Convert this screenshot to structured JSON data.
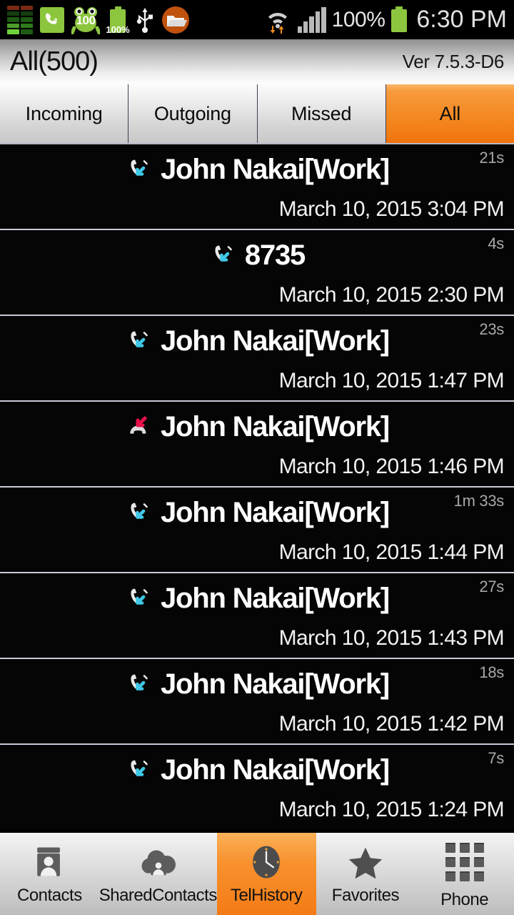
{
  "statusbar": {
    "left_icons": [
      {
        "name": "equalizer-icon"
      },
      {
        "name": "green-phone-icon"
      },
      {
        "name": "frog-icon",
        "badge": "100"
      },
      {
        "name": "battery-saver-icon",
        "badge": "100%"
      },
      {
        "name": "usb-icon"
      },
      {
        "name": "folder-icon"
      }
    ],
    "wifi_icon": "wifi-icon",
    "signal_icon": "signal-bars-icon",
    "battery_percent": "100%",
    "battery_icon": "battery-icon",
    "time": "6:30 PM"
  },
  "header": {
    "title": "All(500)",
    "version": "Ver  7.5.3-D6"
  },
  "tabs": [
    {
      "label": "Incoming",
      "selected": false
    },
    {
      "label": "Outgoing",
      "selected": false
    },
    {
      "label": "Missed",
      "selected": false
    },
    {
      "label": "All",
      "selected": true
    }
  ],
  "calls": [
    {
      "icon": "incoming-call-icon",
      "type": "incoming",
      "name": "John Nakai[Work]",
      "duration": "21s",
      "date": "March 10, 2015 3:04 PM"
    },
    {
      "icon": "incoming-call-icon",
      "type": "incoming",
      "name": "8735",
      "duration": "4s",
      "date": "March 10, 2015 2:30 PM"
    },
    {
      "icon": "incoming-call-icon",
      "type": "incoming",
      "name": "John Nakai[Work]",
      "duration": "23s",
      "date": "March 10, 2015 1:47 PM"
    },
    {
      "icon": "missed-call-icon",
      "type": "missed",
      "name": "John Nakai[Work]",
      "duration": "",
      "date": "March 10, 2015 1:46 PM"
    },
    {
      "icon": "incoming-call-icon",
      "type": "incoming",
      "name": "John Nakai[Work]",
      "duration": "1m 33s",
      "date": "March 10, 2015 1:44 PM"
    },
    {
      "icon": "incoming-call-icon",
      "type": "incoming",
      "name": "John Nakai[Work]",
      "duration": "27s",
      "date": "March 10, 2015 1:43 PM"
    },
    {
      "icon": "incoming-call-icon",
      "type": "incoming",
      "name": "John Nakai[Work]",
      "duration": "18s",
      "date": "March 10, 2015 1:42 PM"
    },
    {
      "icon": "incoming-call-icon",
      "type": "incoming",
      "name": "John Nakai[Work]",
      "duration": "7s",
      "date": "March 10, 2015 1:24 PM"
    }
  ],
  "bottom_nav": [
    {
      "label": "Contacts",
      "icon": "contacts-icon",
      "selected": false
    },
    {
      "label": "SharedContacts",
      "icon": "shared-contacts-icon",
      "selected": false
    },
    {
      "label": "TelHistory",
      "icon": "clock-icon",
      "selected": true
    },
    {
      "label": "Favorites",
      "icon": "star-icon",
      "selected": false
    },
    {
      "label": "Phone",
      "icon": "dialpad-icon",
      "selected": false
    }
  ],
  "colors": {
    "accent_orange": "#f4871f",
    "incoming_arrow": "#3fc8e8",
    "missed_arrow": "#e8114b",
    "battery_green": "#8cc63e",
    "list_background": "#050505"
  }
}
